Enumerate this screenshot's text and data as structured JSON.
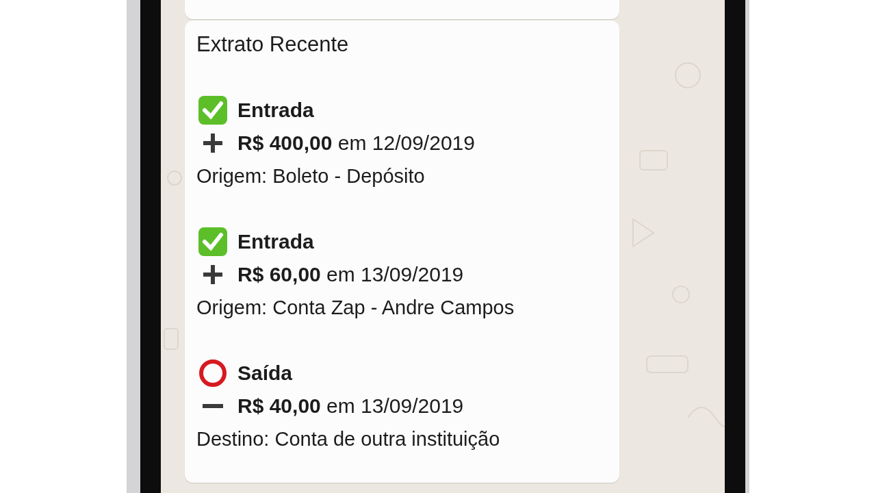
{
  "chat": {
    "message": {
      "title": "Extrato Recente",
      "entries": [
        {
          "kind": "in",
          "type_label": "Entrada",
          "amount": "R$ 400,00",
          "date_text": "em 12/09/2019",
          "detail": "Origem: Boleto - Depósito"
        },
        {
          "kind": "in",
          "type_label": "Entrada",
          "amount": "R$ 60,00",
          "date_text": "em 13/09/2019",
          "detail": "Origem: Conta Zap - Andre Campos"
        },
        {
          "kind": "out",
          "type_label": "Saída",
          "amount": "R$ 40,00",
          "date_text": "em 13/09/2019",
          "detail": "Destino: Conta de outra instituição"
        }
      ]
    }
  }
}
